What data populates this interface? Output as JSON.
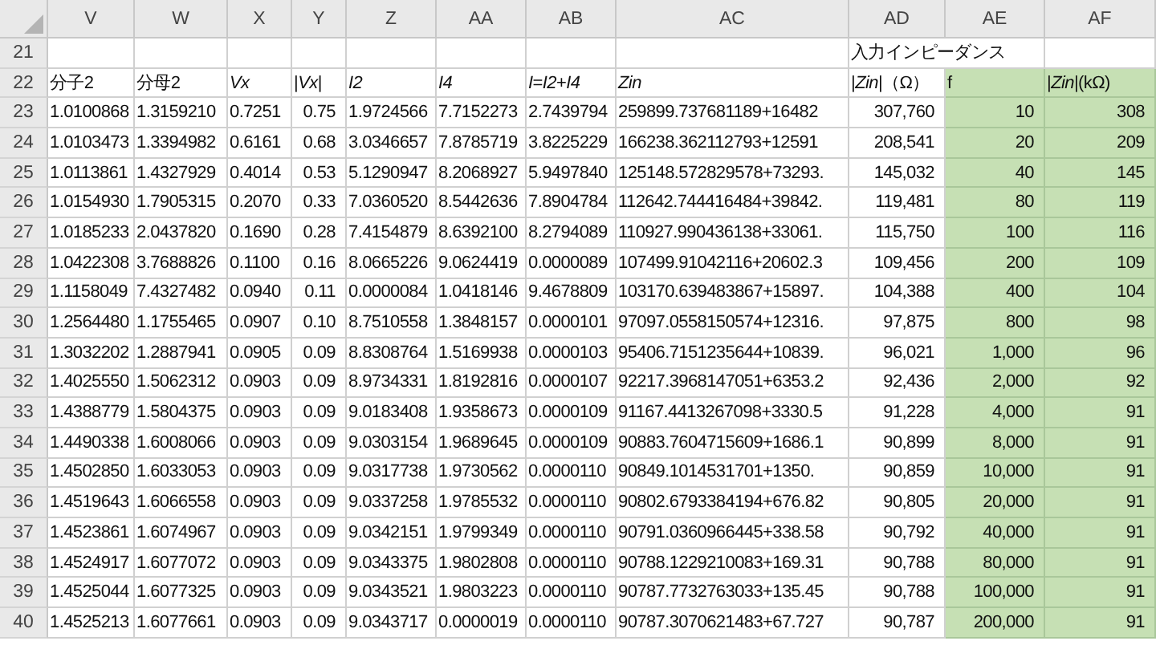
{
  "columns": [
    {
      "label": "V",
      "highlighted": false
    },
    {
      "label": "W",
      "highlighted": false
    },
    {
      "label": "X",
      "highlighted": false
    },
    {
      "label": "Y",
      "highlighted": false
    },
    {
      "label": "Z",
      "highlighted": false
    },
    {
      "label": "AA",
      "highlighted": false
    },
    {
      "label": "AB",
      "highlighted": false
    },
    {
      "label": "AC",
      "highlighted": false
    },
    {
      "label": "AD",
      "highlighted": false
    },
    {
      "label": "AE",
      "highlighted": true
    },
    {
      "label": "AF",
      "highlighted": true
    }
  ],
  "title_row": {
    "number": "21",
    "title": "入力インピーダンス"
  },
  "header_row": {
    "number": "22",
    "headers": [
      "分子2",
      "分母2",
      "*Vx*",
      "|*Vx*|",
      "*I2*",
      "*I4*",
      "*I*=*I2*+*I4*",
      "*Zin*",
      "|*Zin*|（Ω）",
      "f",
      "|*Zin*|(kΩ)"
    ]
  },
  "rows": [
    {
      "number": "23",
      "cells": [
        "1.0100868",
        "1.3159210",
        "0.7251",
        "0.75",
        "1.9724566",
        "7.7152273",
        "2.7439794",
        "259899.737681189+16482",
        "307,760",
        "10",
        "308"
      ]
    },
    {
      "number": "24",
      "cells": [
        "1.0103473",
        "1.3394982",
        "0.6161",
        "0.68",
        "3.0346657",
        "7.8785719",
        "3.8225229",
        "166238.362112793+12591",
        "208,541",
        "20",
        "209"
      ]
    },
    {
      "number": "25",
      "cells": [
        "1.0113861",
        "1.4327929",
        "0.4014",
        "0.53",
        "5.1290947",
        "8.2068927",
        "5.9497840",
        "125148.572829578+73293.",
        "145,032",
        "40",
        "145"
      ]
    },
    {
      "number": "26",
      "cells": [
        "1.0154930",
        "1.7905315",
        "0.2070",
        "0.33",
        "7.0360520",
        "8.5442636",
        "7.8904784",
        "112642.744416484+39842.",
        "119,481",
        "80",
        "119"
      ]
    },
    {
      "number": "27",
      "cells": [
        "1.0185233",
        "2.0437820",
        "0.1690",
        "0.28",
        "7.4154879",
        "8.6392100",
        "8.2794089",
        "110927.990436138+33061.",
        "115,750",
        "100",
        "116"
      ]
    },
    {
      "number": "28",
      "cells": [
        "1.0422308",
        "3.7688826",
        "0.1100",
        "0.16",
        "8.0665226",
        "9.0624419",
        "0.0000089",
        "107499.91042116+20602.3",
        "109,456",
        "200",
        "109"
      ]
    },
    {
      "number": "29",
      "cells": [
        "1.1158049",
        "7.4327482",
        "0.0940",
        "0.11",
        "0.0000084",
        "1.0418146",
        "9.4678809",
        "103170.639483867+15897.",
        "104,388",
        "400",
        "104"
      ]
    },
    {
      "number": "30",
      "cells": [
        "1.2564480",
        "1.1755465",
        "0.0907",
        "0.10",
        "8.7510558",
        "1.3848157",
        "0.0000101",
        "97097.0558150574+12316.",
        "97,875",
        "800",
        "98"
      ]
    },
    {
      "number": "31",
      "cells": [
        "1.3032202",
        "1.2887941",
        "0.0905",
        "0.09",
        "8.8308764",
        "1.5169938",
        "0.0000103",
        "95406.7151235644+10839.",
        "96,021",
        "1,000",
        "96"
      ]
    },
    {
      "number": "32",
      "cells": [
        "1.4025550",
        "1.5062312",
        "0.0903",
        "0.09",
        "8.9734331",
        "1.8192816",
        "0.0000107",
        "92217.3968147051+6353.2",
        "92,436",
        "2,000",
        "92"
      ]
    },
    {
      "number": "33",
      "cells": [
        "1.4388779",
        "1.5804375",
        "0.0903",
        "0.09",
        "9.0183408",
        "1.9358673",
        "0.0000109",
        "91167.4413267098+3330.5",
        "91,228",
        "4,000",
        "91"
      ]
    },
    {
      "number": "34",
      "cells": [
        "1.4490338",
        "1.6008066",
        "0.0903",
        "0.09",
        "9.0303154",
        "1.9689645",
        "0.0000109",
        "90883.7604715609+1686.1",
        "90,899",
        "8,000",
        "91"
      ]
    },
    {
      "number": "35",
      "cells": [
        "1.4502850",
        "1.6033053",
        "0.0903",
        "0.09",
        "9.0317738",
        "1.9730562",
        "0.0000110",
        "90849.1014531701+1350.",
        "90,859",
        "10,000",
        "91"
      ]
    },
    {
      "number": "36",
      "cells": [
        "1.4519643",
        "1.6066558",
        "0.0903",
        "0.09",
        "9.0337258",
        "1.9785532",
        "0.0000110",
        "90802.6793384194+676.82",
        "90,805",
        "20,000",
        "91"
      ]
    },
    {
      "number": "37",
      "cells": [
        "1.4523861",
        "1.6074967",
        "0.0903",
        "0.09",
        "9.0342151",
        "1.9799349",
        "0.0000110",
        "90791.0360966445+338.58",
        "90,792",
        "40,000",
        "91"
      ]
    },
    {
      "number": "38",
      "cells": [
        "1.4524917",
        "1.6077072",
        "0.0903",
        "0.09",
        "9.0343375",
        "1.9802808",
        "0.0000110",
        "90788.1229210083+169.31",
        "90,788",
        "80,000",
        "91"
      ]
    },
    {
      "number": "39",
      "cells": [
        "1.4525044",
        "1.6077325",
        "0.0903",
        "0.09",
        "9.0343521",
        "1.9803223",
        "0.0000110",
        "90787.7732763033+135.45",
        "90,788",
        "100,000",
        "91"
      ]
    },
    {
      "number": "40",
      "cells": [
        "1.4525213",
        "1.6077661",
        "0.0903",
        "0.09",
        "9.0343717",
        "0.0000019",
        "0.0000110",
        "90787.3070621483+67.727",
        "90,787",
        "200,000",
        "91"
      ]
    }
  ]
}
